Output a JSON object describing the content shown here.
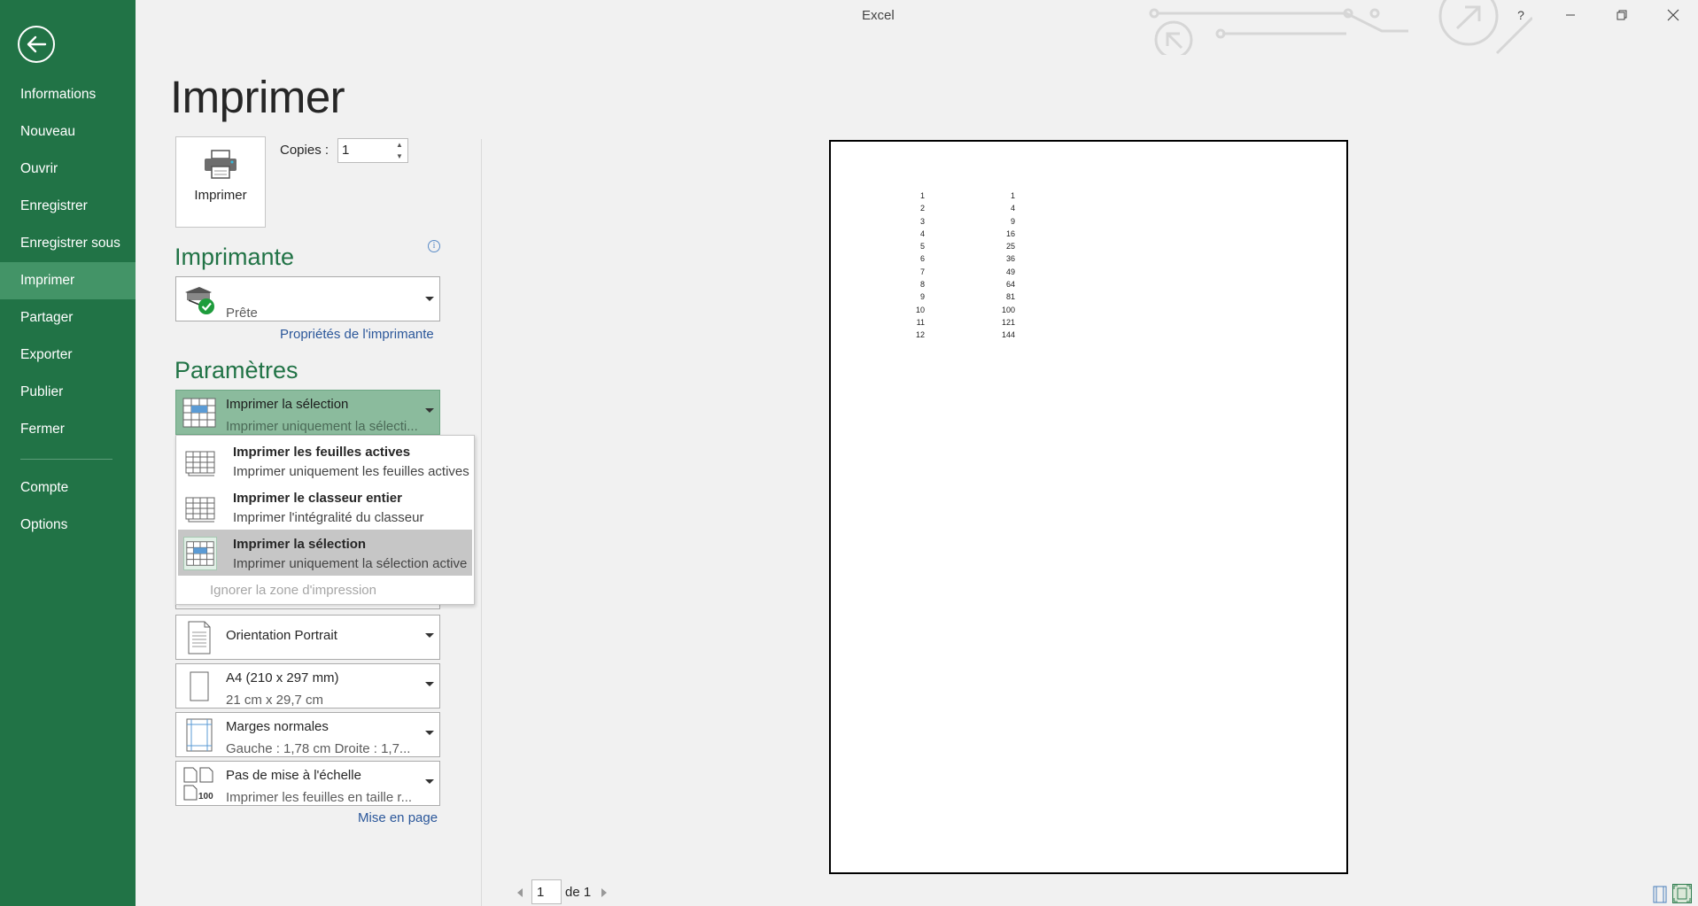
{
  "window": {
    "title": "Excel",
    "help": "?",
    "minimize": "—",
    "restore": "❐",
    "close": "✕"
  },
  "sidebar": {
    "items": [
      {
        "label": "Informations"
      },
      {
        "label": "Nouveau"
      },
      {
        "label": "Ouvrir"
      },
      {
        "label": "Enregistrer"
      },
      {
        "label": "Enregistrer sous"
      },
      {
        "label": "Imprimer",
        "active": true
      },
      {
        "label": "Partager"
      },
      {
        "label": "Exporter"
      },
      {
        "label": "Publier"
      },
      {
        "label": "Fermer"
      }
    ],
    "bottom_items": [
      {
        "label": "Compte"
      },
      {
        "label": "Options"
      }
    ]
  },
  "main": {
    "title": "Imprimer",
    "print_button_label": "Imprimer",
    "copies_label": "Copies :",
    "copies_value": "1",
    "printer_section": "Imprimante",
    "printer_status": "Prête",
    "printer_properties_link": "Propriétés de l'imprimante",
    "settings_section": "Paramètres",
    "print_what": {
      "title": "Imprimer la sélection",
      "subtitle": "Imprimer uniquement la sélecti..."
    },
    "orientation": {
      "title": "Orientation Portrait"
    },
    "paper": {
      "title": "A4 (210 x 297 mm)",
      "subtitle": "21 cm x 29,7 cm"
    },
    "margins": {
      "title": "Marges normales",
      "subtitle": "Gauche :  1,78 cm    Droite :  1,7..."
    },
    "scaling": {
      "title": "Pas de mise à l'échelle",
      "subtitle": "Imprimer les feuilles en taille r...",
      "icon_text": "100"
    },
    "page_setup_link": "Mise en page"
  },
  "popup": {
    "items": [
      {
        "title": "Imprimer les feuilles actives",
        "subtitle": "Imprimer uniquement les feuilles actives"
      },
      {
        "title": "Imprimer le classeur entier",
        "subtitle": "Imprimer l'intégralité du classeur"
      },
      {
        "title": "Imprimer la sélection",
        "subtitle": "Imprimer uniquement la sélection active",
        "selected": true
      }
    ],
    "ignore_print_area": "Ignorer la zone d'impression"
  },
  "preview": {
    "rows": [
      [
        "1",
        "1"
      ],
      [
        "2",
        "4"
      ],
      [
        "3",
        "9"
      ],
      [
        "4",
        "16"
      ],
      [
        "5",
        "25"
      ],
      [
        "6",
        "36"
      ],
      [
        "7",
        "49"
      ],
      [
        "8",
        "64"
      ],
      [
        "9",
        "81"
      ],
      [
        "10",
        "100"
      ],
      [
        "11",
        "121"
      ],
      [
        "12",
        "144"
      ]
    ]
  },
  "pager": {
    "current_page": "1",
    "of_label": "de 1"
  },
  "colors": {
    "accent": "#217346",
    "sidebar_active": "#439467",
    "link": "#2b579a"
  }
}
